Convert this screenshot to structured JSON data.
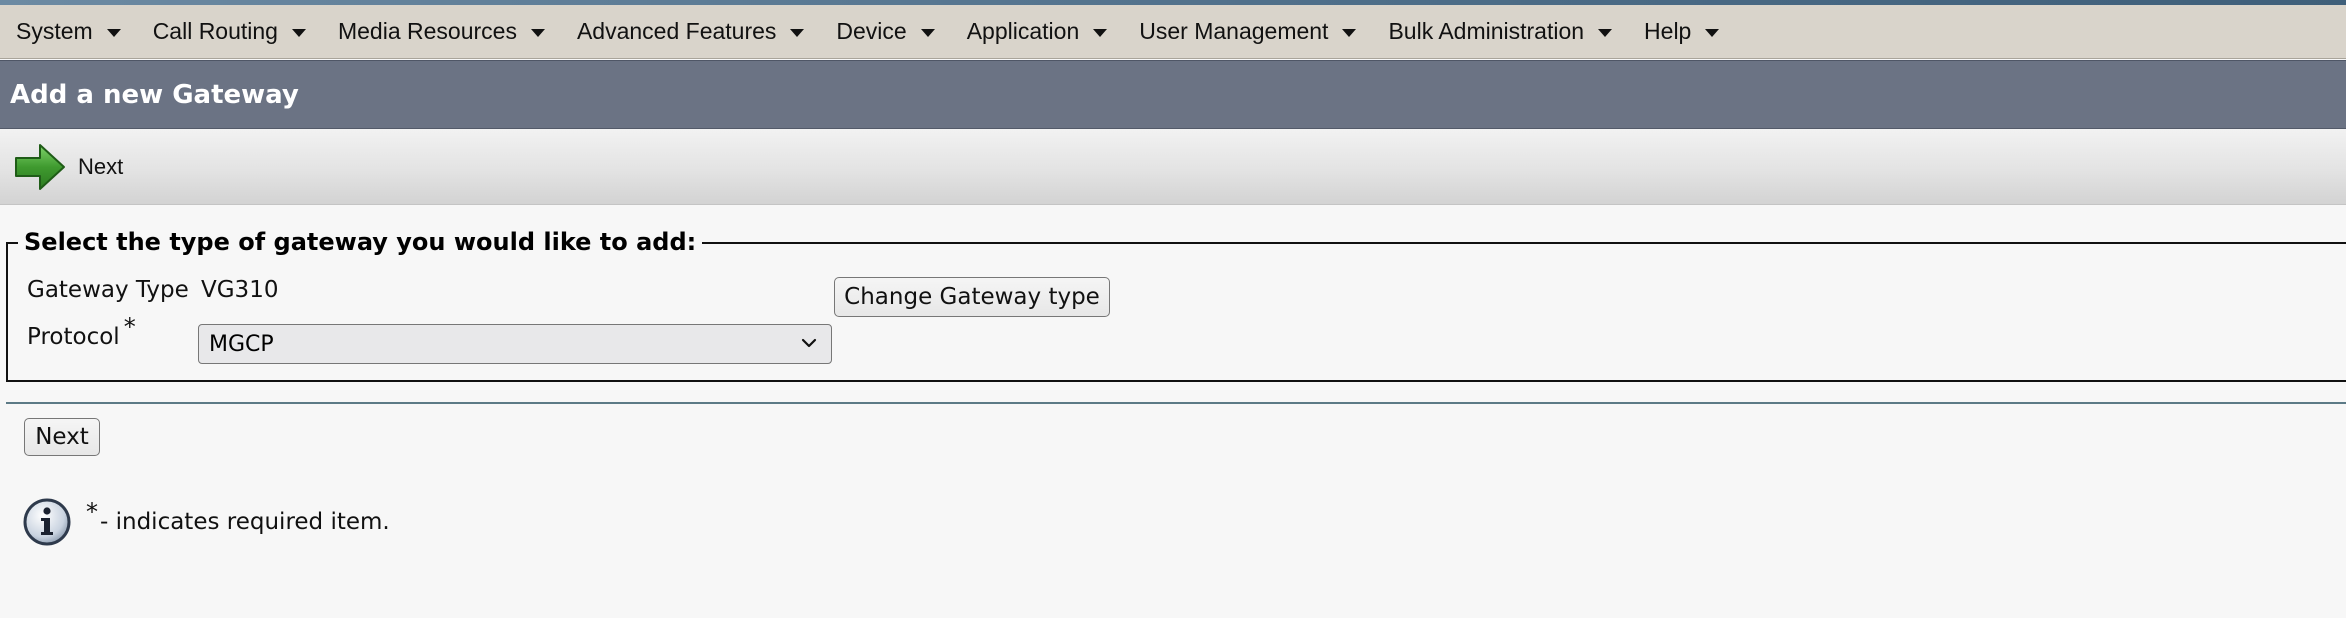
{
  "menu": [
    {
      "label": "System"
    },
    {
      "label": "Call Routing"
    },
    {
      "label": "Media Resources"
    },
    {
      "label": "Advanced Features"
    },
    {
      "label": "Device"
    },
    {
      "label": "Application"
    },
    {
      "label": "User Management"
    },
    {
      "label": "Bulk Administration"
    },
    {
      "label": "Help"
    }
  ],
  "page": {
    "title": "Add a new Gateway"
  },
  "toolbar": {
    "next_label": "Next",
    "next_icon": "green-right-arrow-icon"
  },
  "form": {
    "legend": "Select the type of gateway you would like to add:",
    "gateway_type_label": "Gateway Type",
    "gateway_type_value": "VG310",
    "change_button_label": "Change Gateway type",
    "protocol_label": "Protocol",
    "required_marker": "*",
    "protocol_selected": "MGCP"
  },
  "footer": {
    "next_button_label": "Next",
    "required_marker": "*",
    "required_note": "- indicates required item.",
    "info_icon": "info-icon"
  },
  "colors": {
    "menubar": "#d9d4cb",
    "titlebar": "#6b7384",
    "accent_green": "#3f9a2f"
  }
}
